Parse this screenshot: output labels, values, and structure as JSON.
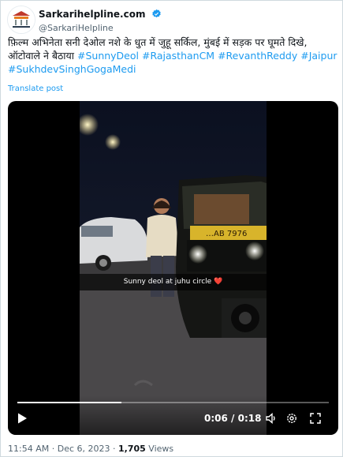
{
  "author": {
    "display_name": "Sarkarihelpline.com",
    "handle": "@SarkariHelpline",
    "verified": true,
    "avatar_icon": "sarkarihelpline-logo-icon"
  },
  "tweet": {
    "text_plain": "फ़िल्म अभिनेता सनी देओल नशे के धुत में जुहू सर्किल, मुंबई में सड़क पर घूमते दिखे, ऑटोवाले ने बैठाया ",
    "hashtags": [
      "#SunnyDeol",
      "#RajasthanCM",
      "#RevanthReddy",
      "#Jaipur",
      "#SukhdevSinghGogaMedi"
    ],
    "translate_label": "Translate post"
  },
  "video": {
    "caption": "Sunny deol at juhu circle ❤️",
    "time_current": "0:06",
    "time_separator": " / ",
    "time_total": "0:18",
    "progress_fraction": 0.333,
    "icons": [
      "play-icon",
      "volume-icon",
      "settings-icon",
      "fullscreen-icon"
    ]
  },
  "footer": {
    "time": "11:54 AM",
    "separator": " · ",
    "date": "Dec 6, 2023",
    "views_count": "1,705",
    "views_label": " Views"
  },
  "colors": {
    "link": "#1d9bf0",
    "text": "#0f1419",
    "muted": "#536471",
    "verified": "#1d9bf0",
    "video_bg": "#000000"
  }
}
